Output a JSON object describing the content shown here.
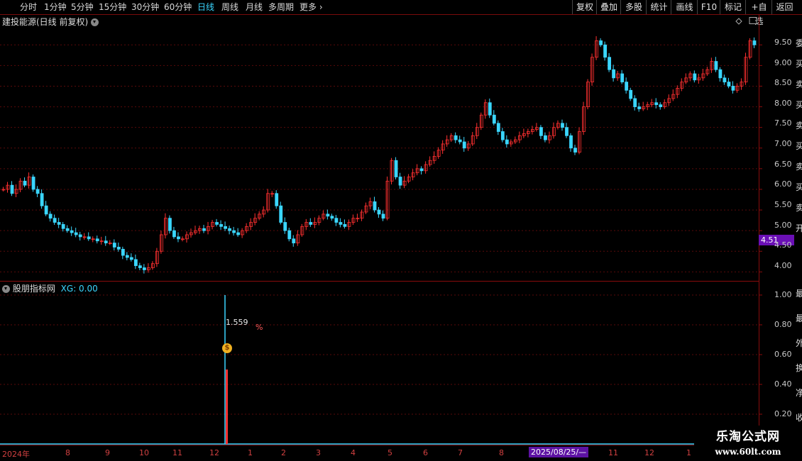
{
  "toolbar": {
    "periods": [
      "分时",
      "1分钟",
      "5分钟",
      "15分钟",
      "30分钟",
      "60分钟",
      "日线",
      "周线",
      "月线",
      "多周期",
      "更多"
    ],
    "active_period": "日线",
    "actions": [
      "复权",
      "叠加",
      "多股",
      "统计",
      "画线",
      "F10",
      "标记",
      "+自选",
      "返回"
    ]
  },
  "stock": {
    "title": "建投能源(日线 前复权)",
    "current_price_badge": "4.51"
  },
  "price_axis": {
    "labels": [
      "9.50",
      "9.00",
      "8.50",
      "8.00",
      "7.50",
      "7.00",
      "6.50",
      "6.00",
      "5.50",
      "5.00",
      "4.50",
      "4.00"
    ]
  },
  "indicator": {
    "name": "股朋指标网",
    "xg_label": "XG: 0.00",
    "value_label": "1.559",
    "pct_label": "%",
    "axis_labels": [
      "1.00",
      "0.80",
      "0.60",
      "0.40",
      "0.20"
    ]
  },
  "time_axis": {
    "labels": [
      "2024年",
      "8",
      "9",
      "10",
      "11",
      "12",
      "1",
      "2",
      "3",
      "4",
      "5",
      "6",
      "7",
      "8",
      "11",
      "12",
      "1"
    ],
    "cursor_date": "2025/08/25/—"
  },
  "watermark": {
    "title": "乐淘公式网",
    "url": "www.60lt.com"
  },
  "right_panel_glyphs": [
    "委",
    "买",
    "卖",
    "买",
    "卖",
    "买",
    "卖",
    "买",
    "卖",
    "开",
    "最",
    "最",
    "外",
    "换",
    "净",
    "收"
  ],
  "colors": {
    "up": "#ff3030",
    "down": "#3ad6ff",
    "grid": "#5a0a0a",
    "badge": "#6a0fb5"
  },
  "chart_data": {
    "type": "candlestick",
    "price_range": [
      3.8,
      9.9
    ],
    "close": [
      6.0,
      6.1,
      5.9,
      6.0,
      6.2,
      6.1,
      6.3,
      6.0,
      5.9,
      5.6,
      5.4,
      5.3,
      5.2,
      5.15,
      5.05,
      5.0,
      4.95,
      4.9,
      4.85,
      4.85,
      4.8,
      4.8,
      4.75,
      4.75,
      4.7,
      4.7,
      4.6,
      4.55,
      4.4,
      4.35,
      4.3,
      4.15,
      4.1,
      4.05,
      4.1,
      4.2,
      4.5,
      4.9,
      5.3,
      5.0,
      4.85,
      4.8,
      4.8,
      4.9,
      4.95,
      5.0,
      5.05,
      5.0,
      5.1,
      5.2,
      5.15,
      5.1,
      5.05,
      5.0,
      4.95,
      4.9,
      5.0,
      5.1,
      5.2,
      5.3,
      5.4,
      5.5,
      5.9,
      5.9,
      5.6,
      5.2,
      5.0,
      4.8,
      4.7,
      4.9,
      5.1,
      5.2,
      5.15,
      5.2,
      5.3,
      5.4,
      5.35,
      5.3,
      5.2,
      5.15,
      5.1,
      5.2,
      5.3,
      5.3,
      5.45,
      5.6,
      5.7,
      5.5,
      5.4,
      5.3,
      6.2,
      6.7,
      6.3,
      6.1,
      6.2,
      6.3,
      6.4,
      6.5,
      6.45,
      6.6,
      6.7,
      6.8,
      6.95,
      7.1,
      7.2,
      7.3,
      7.2,
      7.15,
      7.0,
      7.1,
      7.3,
      7.5,
      7.8,
      8.1,
      7.8,
      7.6,
      7.4,
      7.2,
      7.1,
      7.15,
      7.2,
      7.3,
      7.35,
      7.4,
      7.45,
      7.5,
      7.3,
      7.2,
      7.3,
      7.5,
      7.6,
      7.5,
      7.3,
      7.0,
      6.9,
      7.4,
      8.0,
      8.6,
      9.2,
      9.6,
      9.5,
      9.2,
      8.9,
      8.7,
      8.8,
      8.6,
      8.4,
      8.2,
      8.0,
      7.95,
      8.0,
      8.05,
      8.1,
      8.05,
      8.0,
      8.1,
      8.2,
      8.3,
      8.45,
      8.6,
      8.7,
      8.8,
      8.65,
      8.7,
      8.8,
      8.9,
      9.1,
      8.9,
      8.7,
      8.6,
      8.5,
      8.4,
      8.5,
      8.6,
      9.2,
      9.6,
      9.5
    ],
    "indicator_series": {
      "name": "XG",
      "signal_bar_index": 62,
      "signal_value": 1.0,
      "bar_value": 0.5
    }
  }
}
